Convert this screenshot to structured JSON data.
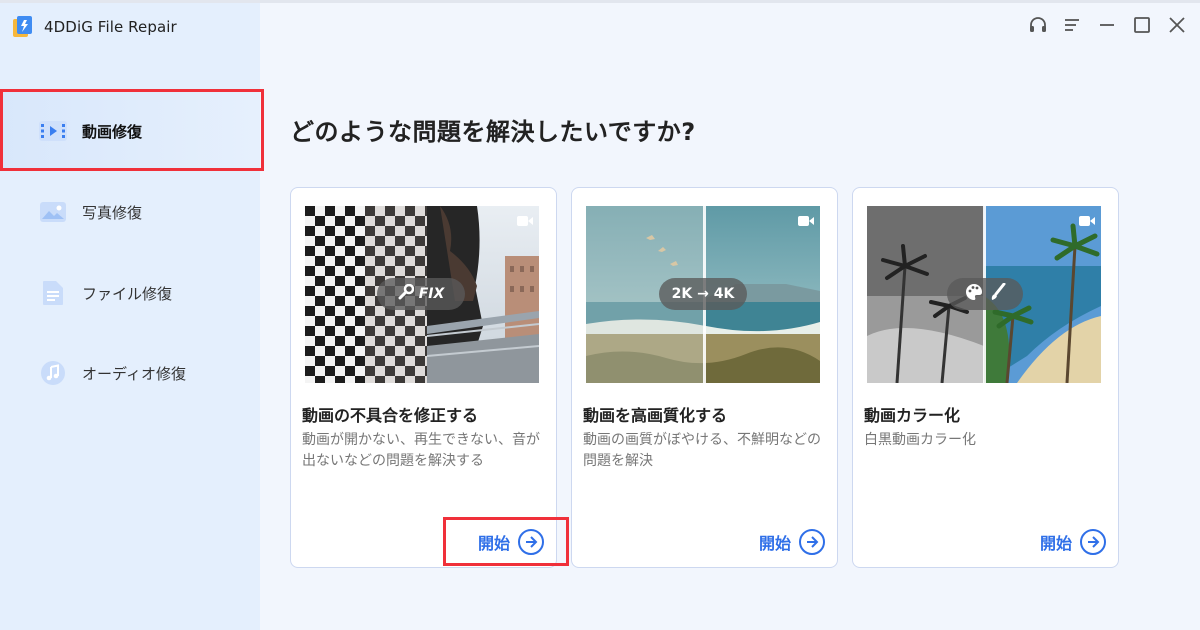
{
  "app": {
    "title": "4DDiG File Repair"
  },
  "sidebar": {
    "items": [
      {
        "label": "動画修復",
        "icon": "video-icon",
        "active": true
      },
      {
        "label": "写真修復",
        "icon": "photo-icon",
        "active": false
      },
      {
        "label": "ファイル修復",
        "icon": "file-icon",
        "active": false
      },
      {
        "label": "オーディオ修復",
        "icon": "audio-icon",
        "active": false
      }
    ]
  },
  "window_controls": [
    "headset-icon",
    "menu-icon",
    "minimize-icon",
    "maximize-icon",
    "close-icon"
  ],
  "main": {
    "title": "どのような問題を解決したいですか?",
    "cards": [
      {
        "badge": "FIX",
        "badge_icon": "wrench-icon",
        "title": "動画の不具合を修正する",
        "description": "動画が開かない、再生できない、音が出ないなどの問題を解決する",
        "button": "開始"
      },
      {
        "badge": "2K → 4K",
        "badge_icon": "",
        "title": "動画を高画質化する",
        "description": "動画の画質がぼやける、不鮮明などの問題を解決",
        "button": "開始"
      },
      {
        "badge": "",
        "badge_icon": "palette-brush-icon",
        "title": "動画カラー化",
        "description": "白黒動画カラー化",
        "button": "開始"
      }
    ]
  },
  "colors": {
    "accent": "#2f6fe8",
    "highlight": "#f0303a",
    "sidebar_bg": "#e4effd",
    "main_bg": "#f2f6fd"
  }
}
